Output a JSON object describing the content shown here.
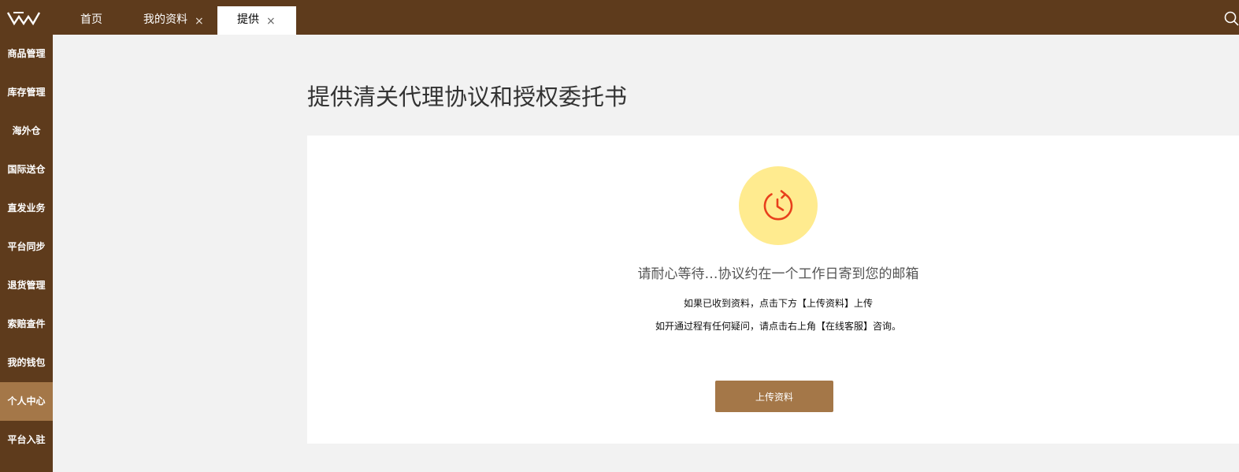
{
  "header": {
    "tabs": [
      {
        "label": "首页",
        "closable": false
      },
      {
        "label": "我的资料",
        "close_glyph": "×"
      },
      {
        "label": "提供",
        "close_glyph": "×",
        "active": true
      }
    ],
    "search_icon": "search-icon",
    "logo_icon": "brand-logo-icon"
  },
  "sidebar": {
    "items": [
      {
        "label": "商品管理"
      },
      {
        "label": "库存管理"
      },
      {
        "label": "海外仓"
      },
      {
        "label": "国际送仓"
      },
      {
        "label": "直发业务"
      },
      {
        "label": "平台同步"
      },
      {
        "label": "退货管理"
      },
      {
        "label": "索赔查件"
      },
      {
        "label": "我的钱包"
      },
      {
        "label": "个人中心",
        "active": true
      },
      {
        "label": "平台入驻"
      }
    ]
  },
  "main": {
    "title": "提供清关代理协议和授权委托书",
    "status_icon": "clock-refresh-icon",
    "wait_text": "请耐心等待…协议约在一个工作日寄到您的邮箱",
    "info_line_1": "如果已收到资料，点击下方【上传资料】上传",
    "info_line_2": "如开通过程有任何疑问，请点击右上角【在线客服】咨询。",
    "upload_button_label": "上传资料"
  },
  "colors": {
    "brand_brown": "#5e3b1c",
    "accent_brown": "#a47748",
    "status_circle": "#ffeb8f",
    "status_icon": "#e8401c"
  }
}
